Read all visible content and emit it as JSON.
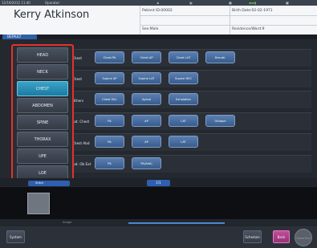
{
  "topbar": {
    "datetime": "12/19/2012 11:40",
    "operator_label": "Operator:"
  },
  "patient": {
    "name": "Kerry Atkinson",
    "patient_id": "Patient ID:00002",
    "birth_date": "Birth Date:02-02-1971",
    "sex": "Sex:Male",
    "residence": "Residence/Ward:9"
  },
  "tab": {
    "label": "DEFAULT"
  },
  "body_parts": {
    "items": [
      "HEAD",
      "NECK",
      "CHEST",
      "ABDOMEN",
      "SPINE",
      "THORAX",
      "UPE",
      "LOE"
    ],
    "selected": "CHEST",
    "selected_color": "#2a93bb",
    "highlight_color": "#e8302a"
  },
  "exam_rows": [
    {
      "label": "Chest",
      "buttons": [
        "Chest PA",
        "Chest AP",
        "Chest LAT",
        "Decubi."
      ]
    },
    {
      "label": "Chest",
      "buttons": [
        "Supine AP",
        "Supine LAT",
        "Supine DEC"
      ]
    },
    {
      "label": "Others",
      "buttons": [
        "Chest Obl.",
        "Apical",
        "Exhalation"
      ]
    },
    {
      "label": "Lat. Chest",
      "buttons": [
        "PA",
        "AP",
        "LAT",
        "Oblique"
      ]
    },
    {
      "label": "Chest Abd",
      "buttons": [
        "PA",
        "AP",
        "LAT"
      ]
    },
    {
      "label": "Lat. Ob Ext",
      "buttons": [
        "PA",
        "PA(Abd)"
      ]
    }
  ],
  "pagination": {
    "current": "1/1"
  },
  "thumbnails": {
    "strip_label": "Stitch"
  },
  "timeline": {
    "label": "Image"
  },
  "footer": {
    "system": "System",
    "schedule": "Schedule",
    "back": "Back",
    "end": "Exam End"
  }
}
